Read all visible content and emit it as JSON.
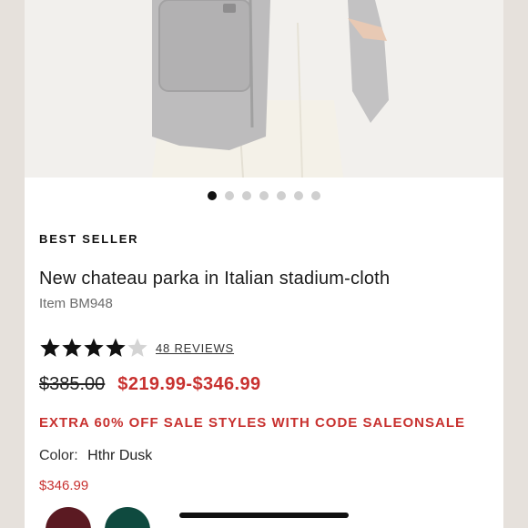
{
  "product": {
    "badge": "BEST SELLER",
    "title": "New chateau parka in Italian stadium-cloth",
    "item_number": "Item BM948",
    "rating": 4,
    "rating_max": 5,
    "reviews_label": "48 REVIEWS",
    "original_price": "$385.00",
    "sale_price_range": "$219.99-$346.99",
    "promo": "EXTRA 60% OFF SALE STYLES WITH CODE SALEONSALE",
    "color_label": "Color:",
    "color_value": "Hthr Dusk",
    "color_price": "$346.99"
  },
  "carousel": {
    "total_images": 7,
    "active_index": 0
  },
  "colors": {
    "sale_red": "#c8312f",
    "swatches": [
      "#5b1a22",
      "#0f4a3f"
    ]
  }
}
